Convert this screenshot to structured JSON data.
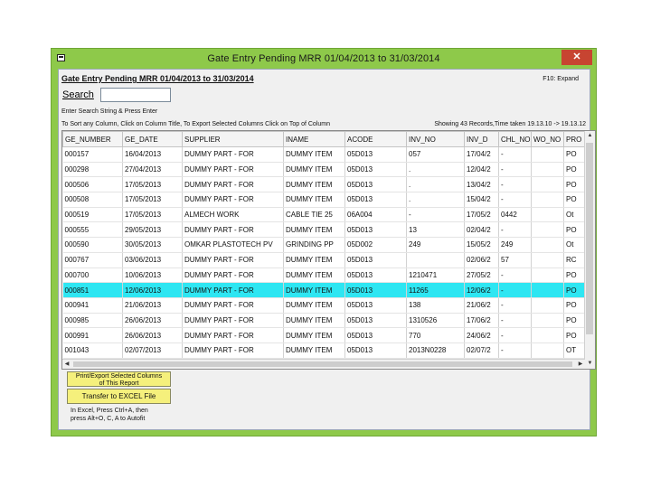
{
  "window": {
    "title": "Gate Entry Pending MRR 01/04/2013 to 31/03/2014",
    "close_label": "✕"
  },
  "header": {
    "heading": "Gate Entry Pending MRR 01/04/2013 to 31/03/2014",
    "expand_hint": "F10: Expand"
  },
  "search": {
    "label": "Search",
    "value": "",
    "hint": "Enter Search String & Press Enter"
  },
  "sort_hint": "To Sort any Column, Click on Column Title, To Export Selected Columns Click on Top of Column",
  "records_info": "Showing 43 Records,Time taken 19.13.10 -> 19.13.12",
  "grid": {
    "columns": [
      "GE_NUMBER",
      "GE_DATE",
      "SUPPLIER",
      "INAME",
      "ACODE",
      "INV_NO",
      "INV_D",
      "CHL_NO",
      "WO_NO",
      "PRO"
    ],
    "rows": [
      [
        "000157",
        "16/04/2013",
        "DUMMY PART - FOR",
        "DUMMY ITEM",
        "05D013",
        "057",
        "17/04/2",
        "-",
        "",
        "PO"
      ],
      [
        "000298",
        "27/04/2013",
        "DUMMY PART - FOR",
        "DUMMY ITEM",
        "05D013",
        ".",
        "12/04/2",
        "-",
        "",
        "PO"
      ],
      [
        "000506",
        "17/05/2013",
        "DUMMY PART - FOR",
        "DUMMY ITEM",
        "05D013",
        ".",
        "13/04/2",
        "-",
        "",
        "PO"
      ],
      [
        "000508",
        "17/05/2013",
        "DUMMY PART - FOR",
        "DUMMY ITEM",
        "05D013",
        ".",
        "15/04/2",
        "-",
        "",
        "PO"
      ],
      [
        "000519",
        "17/05/2013",
        "ALMECH WORK",
        "CABLE TIE 25",
        "06A004",
        "-",
        "17/05/2",
        "0442",
        "",
        "Ot"
      ],
      [
        "000555",
        "29/05/2013",
        "DUMMY PART - FOR",
        "DUMMY ITEM",
        "05D013",
        "13",
        "02/04/2",
        "-",
        "",
        "PO"
      ],
      [
        "000590",
        "30/05/2013",
        "OMKAR PLASTOTECH PV",
        "GRINDING PP",
        "05D002",
        "249",
        "15/05/2",
        "249",
        "",
        "Ot"
      ],
      [
        "000767",
        "03/06/2013",
        "DUMMY PART - FOR",
        "DUMMY ITEM",
        "05D013",
        "",
        "02/06/2",
        "57",
        "",
        "RC"
      ],
      [
        "000700",
        "10/06/2013",
        "DUMMY PART - FOR",
        "DUMMY ITEM",
        "05D013",
        "1210471",
        "27/05/2",
        "-",
        "",
        "PO"
      ],
      [
        "000851",
        "12/06/2013",
        "DUMMY PART - FOR",
        "DUMMY ITEM",
        "05D013",
        "11265",
        "12/06/2",
        "-",
        "",
        "PO"
      ],
      [
        "000941",
        "21/06/2013",
        "DUMMY PART - FOR",
        "DUMMY ITEM",
        "05D013",
        "138",
        "21/06/2",
        "-",
        "",
        "PO"
      ],
      [
        "000985",
        "26/06/2013",
        "DUMMY PART - FOR",
        "DUMMY ITEM",
        "05D013",
        "1310526",
        "17/06/2",
        "-",
        "",
        "PO"
      ],
      [
        "000991",
        "26/06/2013",
        "DUMMY PART - FOR",
        "DUMMY ITEM",
        "05D013",
        "770",
        "24/06/2",
        "-",
        "",
        "PO"
      ],
      [
        "001043",
        "02/07/2013",
        "DUMMY PART - FOR",
        "DUMMY ITEM",
        "05D013",
        "2013N0228",
        "02/07/2",
        "-",
        "",
        "OT"
      ]
    ],
    "selected_row": 9
  },
  "buttons": {
    "print_export_line1": "Print/Export Selected Columns",
    "print_export_line2": "of This Report",
    "transfer_excel": "Transfer to EXCEL File"
  },
  "notes": {
    "line1": "In Excel, Press Ctrl+A, then",
    "line2": "press Alt+O, C, A to Autofit"
  },
  "colors": {
    "window_frame": "#8ec94a",
    "selected_row": "#2ee6f2",
    "button_fill": "#f5f07c",
    "close_button": "#c74431"
  }
}
